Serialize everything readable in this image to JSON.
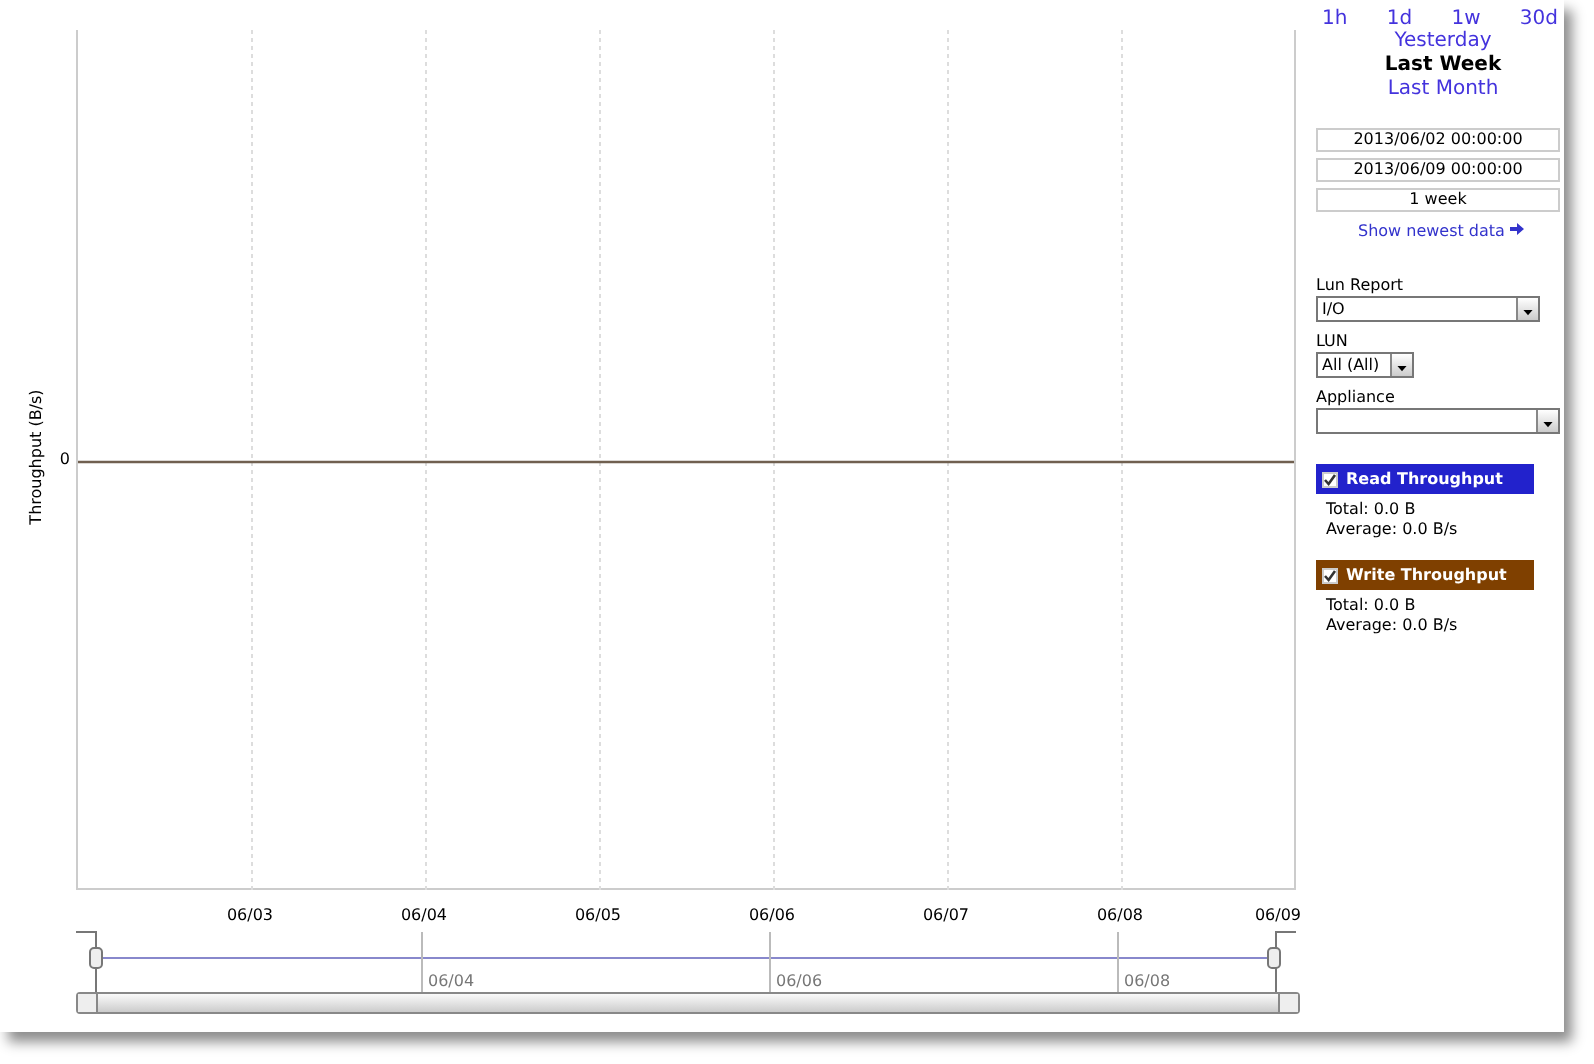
{
  "chart": {
    "y_axis_label": "Throughput (B/s)",
    "y_ticks": [
      "0"
    ],
    "x_ticks": [
      "06/03",
      "06/04",
      "06/05",
      "06/06",
      "06/07",
      "06/08",
      "06/09"
    ]
  },
  "navigator": {
    "labels": [
      "06/04",
      "06/06",
      "06/08"
    ]
  },
  "ranges": [
    {
      "label": "1h",
      "selected": false
    },
    {
      "label": "1d",
      "selected": false
    },
    {
      "label": "1w",
      "selected": false
    },
    {
      "label": "30d",
      "selected": false
    }
  ],
  "presets": [
    {
      "label": "Yesterday",
      "selected": false
    },
    {
      "label": "Last Week",
      "selected": true
    },
    {
      "label": "Last Month",
      "selected": false
    }
  ],
  "start": "2013/06/02 00:00:00",
  "end": "2013/06/09 00:00:00",
  "duration": "1 week",
  "newest_link": "Show newest data",
  "selects": [
    {
      "label": "Lun Report",
      "value": "I/O"
    },
    {
      "label": "LUN",
      "value": "All (All)"
    },
    {
      "label": "Appliance"
    }
  ],
  "series": [
    {
      "name": "Read Throughput",
      "color": "#2222cc",
      "checked": true,
      "total": "Total: 0.0 B",
      "average": "Average: 0.0 B/s"
    },
    {
      "name": "Write Throughput",
      "color": "#7f4000",
      "checked": true,
      "total": "Total: 0.0 B",
      "average": "Average: 0.0 B/s"
    }
  ]
}
